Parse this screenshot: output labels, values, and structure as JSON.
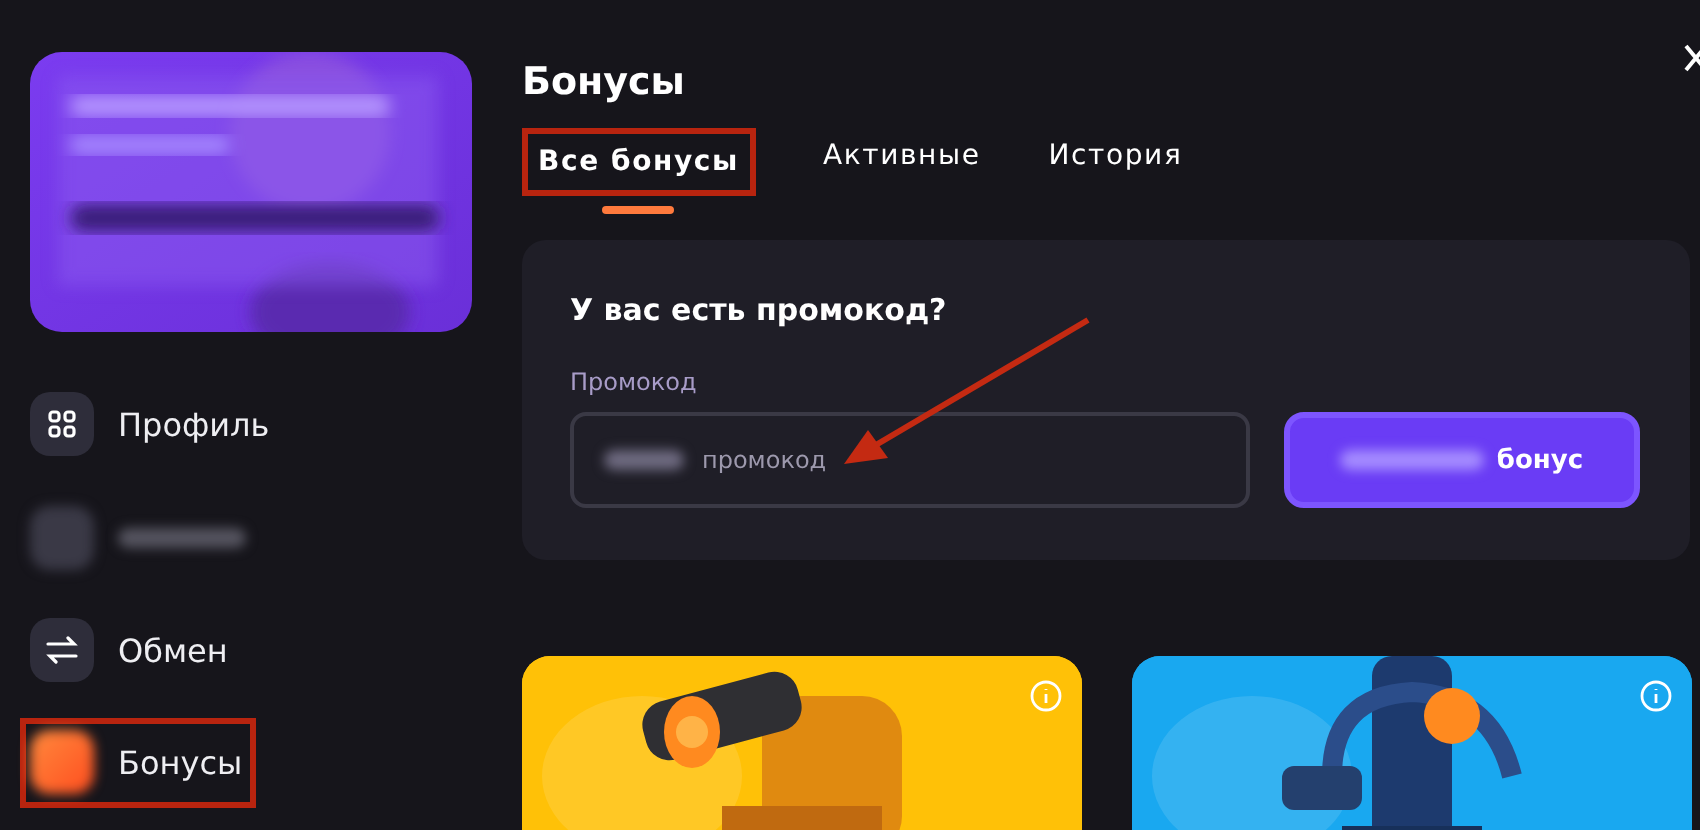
{
  "sidebar": {
    "items": [
      {
        "kind": "grid",
        "label": "Профиль",
        "highlighted": false
      },
      {
        "kind": "redacted",
        "highlighted": false
      },
      {
        "kind": "swap",
        "label": "Обмен",
        "highlighted": false
      },
      {
        "kind": "bonus",
        "label": "Бонусы",
        "highlighted": true
      }
    ]
  },
  "page": {
    "title": "Бонусы"
  },
  "tabs": [
    {
      "label": "Все бонусы",
      "selected": true,
      "highlighted": true
    },
    {
      "label": "Активные",
      "selected": false,
      "highlighted": false
    },
    {
      "label": "История",
      "selected": false,
      "highlighted": false
    }
  ],
  "promo": {
    "heading": "У вас есть промокод?",
    "field_label": "Промокод",
    "placeholder": "промокод",
    "button": "бонус"
  },
  "bonus_cards": [
    {
      "color": "#ffc107"
    },
    {
      "color": "#19a8f0"
    }
  ]
}
